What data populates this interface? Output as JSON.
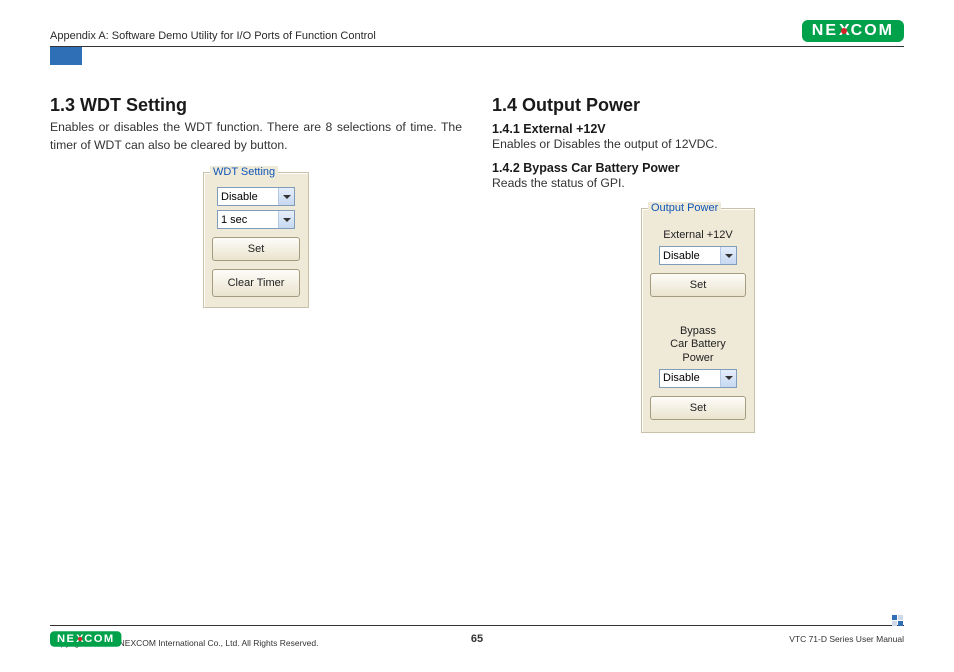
{
  "header": {
    "appendix": "Appendix A: Software Demo Utility for I/O Ports of Function Control",
    "logo_ne": "NE",
    "logo_x": "X",
    "logo_com": "COM"
  },
  "left": {
    "heading": "1.3  WDT Setting",
    "body": "Enables or disables the WDT function. There are 8 selections of time. The timer of WDT can also be cleared by button.",
    "panel": {
      "legend": "WDT Setting",
      "select_enable": "Disable",
      "select_time": "1 sec",
      "btn_set": "Set",
      "btn_clear": "Clear Timer"
    }
  },
  "right": {
    "heading": "1.4  Output Power",
    "sub1_heading": "1.4.1  External +12V",
    "sub1_body": "Enables or Disables the output of 12VDC.",
    "sub2_heading": "1.4.2  Bypass Car Battery Power",
    "sub2_body": "Reads the status of GPI.",
    "panel": {
      "legend": "Output Power",
      "label_ext": "External +12V",
      "select_ext": "Disable",
      "btn_set_ext": "Set",
      "label_bypass_l1": "Bypass",
      "label_bypass_l2": "Car Battery",
      "label_bypass_l3": "Power",
      "select_bypass": "Disable",
      "btn_set_bypass": "Set"
    }
  },
  "footer": {
    "copyright": "Copyright © 2012 NEXCOM International Co., Ltd. All Rights Reserved.",
    "page_number": "65",
    "manual": "VTC 71-D Series User Manual"
  }
}
